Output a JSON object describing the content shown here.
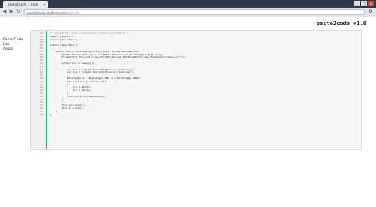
{
  "browser": {
    "tab_title": "paste2code :: code",
    "url_host": "paste2code.sodhera.org",
    "url_path": "/code/10",
    "controls": [
      "_",
      "□",
      "x"
    ]
  },
  "site": {
    "title": "paste2code v1.0"
  },
  "sidebar": {
    "items": [
      "Paste Code",
      "List",
      "About"
    ]
  },
  "code": {
    "lines": [
      {
        "n": "01",
        "t": "/* paste2code: http://paste2code.sodhera.org/code/10 */"
      },
      {
        "n": "02",
        "t": "import java.io.*;"
      },
      {
        "n": "03",
        "t": "import java.math.*;"
      },
      {
        "n": "04",
        "t": ""
      },
      {
        "n": "05",
        "t": "public class Main {"
      },
      {
        "n": "06",
        "t": ""
      },
      {
        "n": "07",
        "t": "    public static void main(String[] args) throws IOException{"
      },
      {
        "n": "08",
        "t": "        BufferedReader file_in = new BufferedReader(new FileReader(\"data.in\"));"
      },
      {
        "n": "09",
        "t": "        PrintWriter file_out = new PrintWriter(new BufferedWriter(new FileWriter(\"data.out\")));"
      },
      {
        "n": "10",
        "t": ""
      },
      {
        "n": "11",
        "t": "        while(file_in.ready()){"
      },
      {
        "n": "12",
        "t": ""
      },
      {
        "n": "13",
        "t": "            int max = Integer.parseInt(file_in.readLine());"
      },
      {
        "n": "14",
        "t": "            int its = Integer.parseInt(file_in.readLine());"
      },
      {
        "n": "15",
        "t": ""
      },
      {
        "n": "16",
        "t": "            BigInteger a = BigInteger.ONE, b = BigInteger.ZERO;"
      },
      {
        "n": "17",
        "t": "            for (int i = 0; i<its; i++)"
      },
      {
        "n": "18",
        "t": "            {"
      },
      {
        "n": "19",
        "t": "                a = a.add(b);"
      },
      {
        "n": "20",
        "t": "                b = a.add(b);"
      },
      {
        "n": "21",
        "t": "            }"
      },
      {
        "n": "22",
        "t": "            file_out.println(a.mod(b));"
      },
      {
        "n": "23",
        "t": "        }"
      },
      {
        "n": "24",
        "t": ""
      },
      {
        "n": "25",
        "t": "        file_out.close();"
      },
      {
        "n": "26",
        "t": "        file_in.close();"
      },
      {
        "n": "27",
        "t": "    }"
      },
      {
        "n": "28",
        "t": "}"
      }
    ]
  }
}
